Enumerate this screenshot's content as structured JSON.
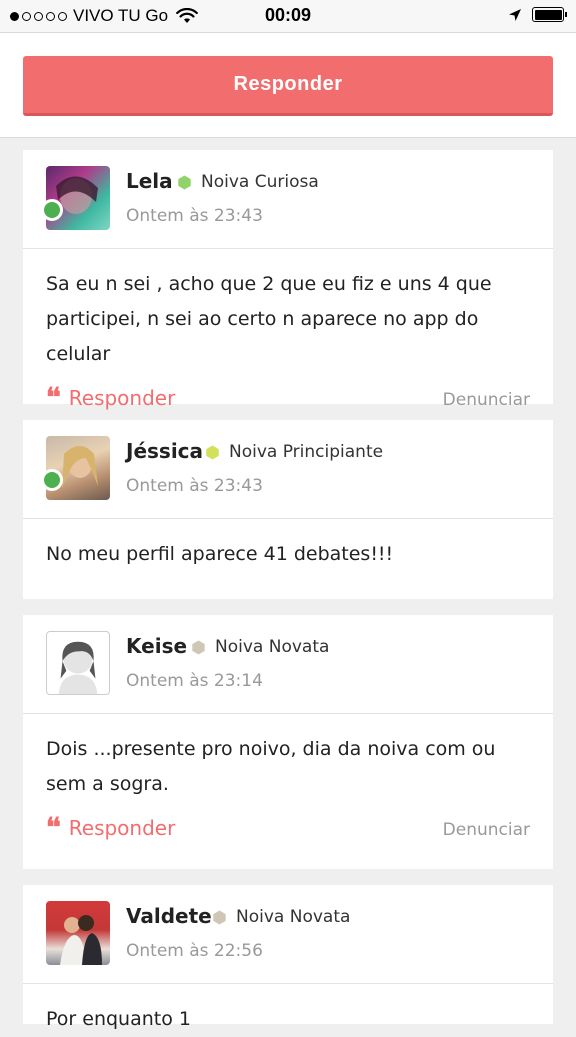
{
  "status_bar": {
    "carrier": "VIVO TU Go",
    "time": "00:09"
  },
  "reply_button_label": "Responder",
  "posts": [
    {
      "author": "Lela",
      "rank": "Noiva Curiosa",
      "rank_color": "#8fd36a",
      "time": "Ontem às 23:43",
      "text": "Sa eu n sei , acho que 2 que eu fiz e uns 4 que participei, n sei ao certo n aparece no app do celular",
      "online": true,
      "reply_label": "Responder",
      "report_label": "Denunciar"
    },
    {
      "author": "Jéssica",
      "rank": "Noiva Principiante",
      "rank_color": "#d3e05a",
      "time": "Ontem às 23:43",
      "text": "No meu perfil aparece 41 debates!!!",
      "online": true
    },
    {
      "author": "Keise",
      "rank": "Noiva Novata",
      "rank_color": "#cfc7b5",
      "time": "Ontem às 23:14",
      "text": "Dois ...presente pro noivo, dia da noiva com ou sem a sogra.",
      "online": false,
      "reply_label": "Responder",
      "report_label": "Denunciar"
    },
    {
      "author": "Valdete",
      "rank": "Noiva Novata",
      "rank_color": "#cfc7b5",
      "time": "Ontem às 22:56",
      "text": "Por enquanto 1",
      "online": false
    }
  ],
  "colors": {
    "accent": "#f26e6e",
    "online": "#4caf50",
    "muted_text": "#999999",
    "background": "#efefef"
  },
  "icons": {
    "wifi": "wifi-icon",
    "location": "location-arrow-icon",
    "battery": "battery-icon",
    "quote": "quote-icon",
    "rank": "hexagon-badge-icon"
  }
}
